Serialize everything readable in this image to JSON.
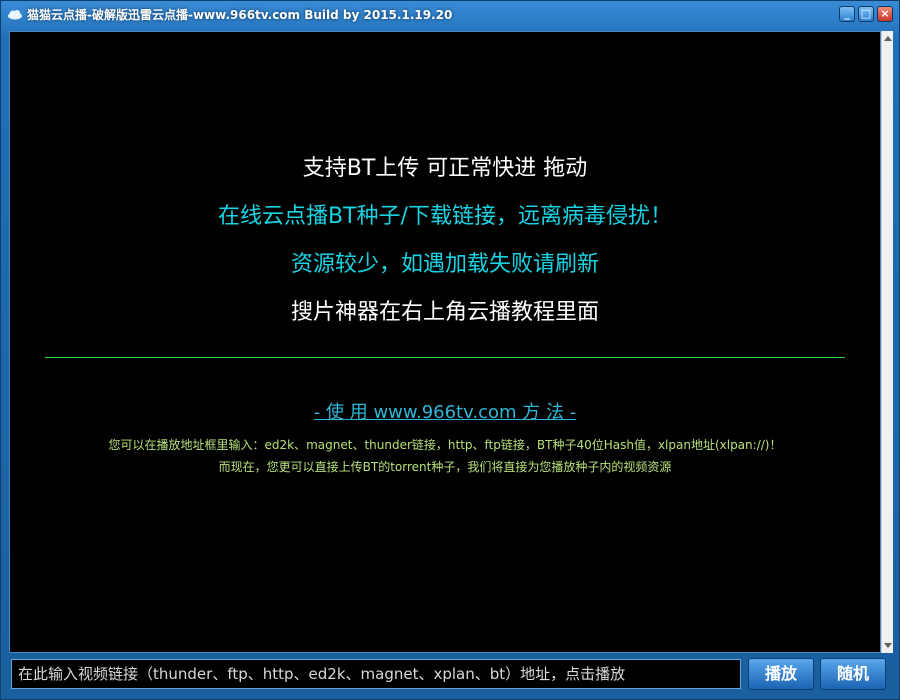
{
  "window": {
    "title": "猫猫云点播-破解版迅雷云点播-www.966tv.com Build by 2015.1.19.20",
    "minimize_label": "_",
    "maximize_label": "□",
    "close_label": "×"
  },
  "content": {
    "line1": "支持BT上传 可正常快进 拖动",
    "line2": "在线云点播BT种子/下载链接，远离病毒侵扰！",
    "line3": "资源较少，如遇加载失败请刷新",
    "line4": "搜片神器在右上角云播教程里面",
    "usage_link": "- 使 用 www.966tv.com 方 法 -",
    "desc1": "您可以在播放地址框里输入：ed2k、magnet、thunder链接，http、ftp链接，BT种子40位Hash值，xlpan地址(xlpan://)！",
    "desc2": "而现在，您更可以直接上传BT的torrent种子，我们将直接为您播放种子内的视频资源"
  },
  "bottom": {
    "input_placeholder": "在此输入视频链接（thunder、ftp、http、ed2k、magnet、xplan、bt）地址，点击播放",
    "input_value": "",
    "play_label": "播放",
    "random_label": "随机"
  },
  "colors": {
    "white_text": "#ffffff",
    "cyan_text": "#19d3e3",
    "divider": "#2fd53a",
    "link": "#2fb6d8",
    "desc": "#b7e07a"
  },
  "icons": {
    "app": "cloud-icon",
    "minimize": "minimize-icon",
    "maximize": "maximize-icon",
    "close": "close-icon"
  }
}
